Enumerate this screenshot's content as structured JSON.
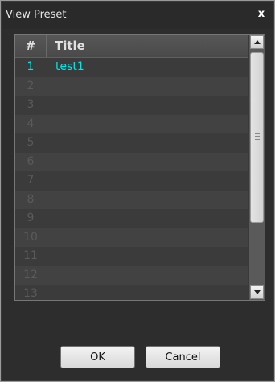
{
  "window": {
    "title": "View Preset",
    "close_glyph": "x"
  },
  "table": {
    "columns": [
      "#",
      "Title"
    ],
    "rows": [
      {
        "num": "1",
        "title": "test1"
      },
      {
        "num": "2",
        "title": ""
      },
      {
        "num": "3",
        "title": ""
      },
      {
        "num": "4",
        "title": ""
      },
      {
        "num": "5",
        "title": ""
      },
      {
        "num": "6",
        "title": ""
      },
      {
        "num": "7",
        "title": ""
      },
      {
        "num": "8",
        "title": ""
      },
      {
        "num": "9",
        "title": ""
      },
      {
        "num": "10",
        "title": ""
      },
      {
        "num": "11",
        "title": ""
      },
      {
        "num": "12",
        "title": ""
      },
      {
        "num": "13",
        "title": ""
      }
    ]
  },
  "buttons": {
    "ok_label": "OK",
    "cancel_label": "Cancel"
  },
  "colors": {
    "background": "#2d2d2d",
    "accent_text": "#00e8e8"
  }
}
